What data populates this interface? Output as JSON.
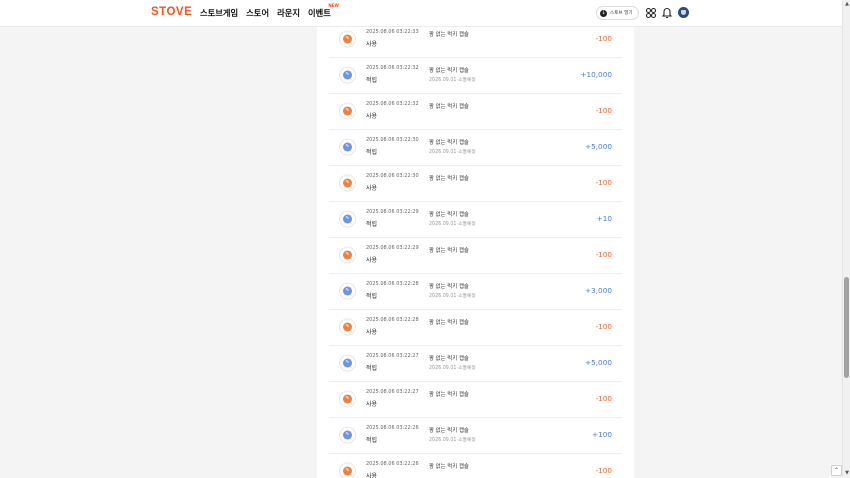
{
  "header": {
    "logo": "STOVE",
    "nav": [
      {
        "label": "스토브게임",
        "badge": ""
      },
      {
        "label": "스토어",
        "badge": ""
      },
      {
        "label": "라운지",
        "badge": ""
      },
      {
        "label": "이벤트",
        "badge": "NEW"
      }
    ],
    "launcher_label": "스토브 열기",
    "icons": [
      "apps-grid-icon",
      "bell-icon",
      "avatar"
    ]
  },
  "colors": {
    "brand": "#ff4f17",
    "use_amount": "#f06a3a",
    "earn_amount": "#4d7ce0"
  },
  "history": [
    {
      "date": "2025.08.06 03:22:33",
      "type": "사용",
      "desc": "팡 없는 럭키 캡슐",
      "sub": "",
      "amount": "-100",
      "kind": "use"
    },
    {
      "date": "2025.08.06 03:22:32",
      "type": "적립",
      "desc": "팡 없는 럭키 캡슐",
      "sub": "2026.09.01 소멸예정",
      "amount": "+10,000",
      "kind": "earn"
    },
    {
      "date": "2025.08.06 03:22:32",
      "type": "사용",
      "desc": "팡 없는 럭키 캡슐",
      "sub": "",
      "amount": "-100",
      "kind": "use"
    },
    {
      "date": "2025.08.06 03:22:30",
      "type": "적립",
      "desc": "팡 없는 럭키 캡슐",
      "sub": "2026.09.01 소멸예정",
      "amount": "+5,000",
      "kind": "earn"
    },
    {
      "date": "2025.08.06 03:22:30",
      "type": "사용",
      "desc": "팡 없는 럭키 캡슐",
      "sub": "",
      "amount": "-100",
      "kind": "use"
    },
    {
      "date": "2025.08.06 03:22:29",
      "type": "적립",
      "desc": "팡 없는 럭키 캡슐",
      "sub": "2026.09.01 소멸예정",
      "amount": "+10",
      "kind": "earn"
    },
    {
      "date": "2025.08.06 03:22:29",
      "type": "사용",
      "desc": "팡 없는 럭키 캡슐",
      "sub": "",
      "amount": "-100",
      "kind": "use"
    },
    {
      "date": "2025.08.06 03:22:28",
      "type": "적립",
      "desc": "팡 없는 럭키 캡슐",
      "sub": "2026.09.01 소멸예정",
      "amount": "+3,000",
      "kind": "earn"
    },
    {
      "date": "2025.08.06 03:22:28",
      "type": "사용",
      "desc": "팡 없는 럭키 캡슐",
      "sub": "",
      "amount": "-100",
      "kind": "use"
    },
    {
      "date": "2025.08.06 03:22:27",
      "type": "적립",
      "desc": "팡 없는 럭키 캡슐",
      "sub": "2026.09.01 소멸예정",
      "amount": "+5,000",
      "kind": "earn"
    },
    {
      "date": "2025.08.06 03:22:27",
      "type": "사용",
      "desc": "팡 없는 럭키 캡슐",
      "sub": "",
      "amount": "-100",
      "kind": "use"
    },
    {
      "date": "2025.08.06 03:22:26",
      "type": "적립",
      "desc": "팡 없는 럭키 캡슐",
      "sub": "2026.09.01 소멸예정",
      "amount": "+100",
      "kind": "earn"
    },
    {
      "date": "2025.08.06 03:22:26",
      "type": "사용",
      "desc": "팡 없는 럭키 캡슐",
      "sub": "",
      "amount": "-100",
      "kind": "use"
    }
  ]
}
